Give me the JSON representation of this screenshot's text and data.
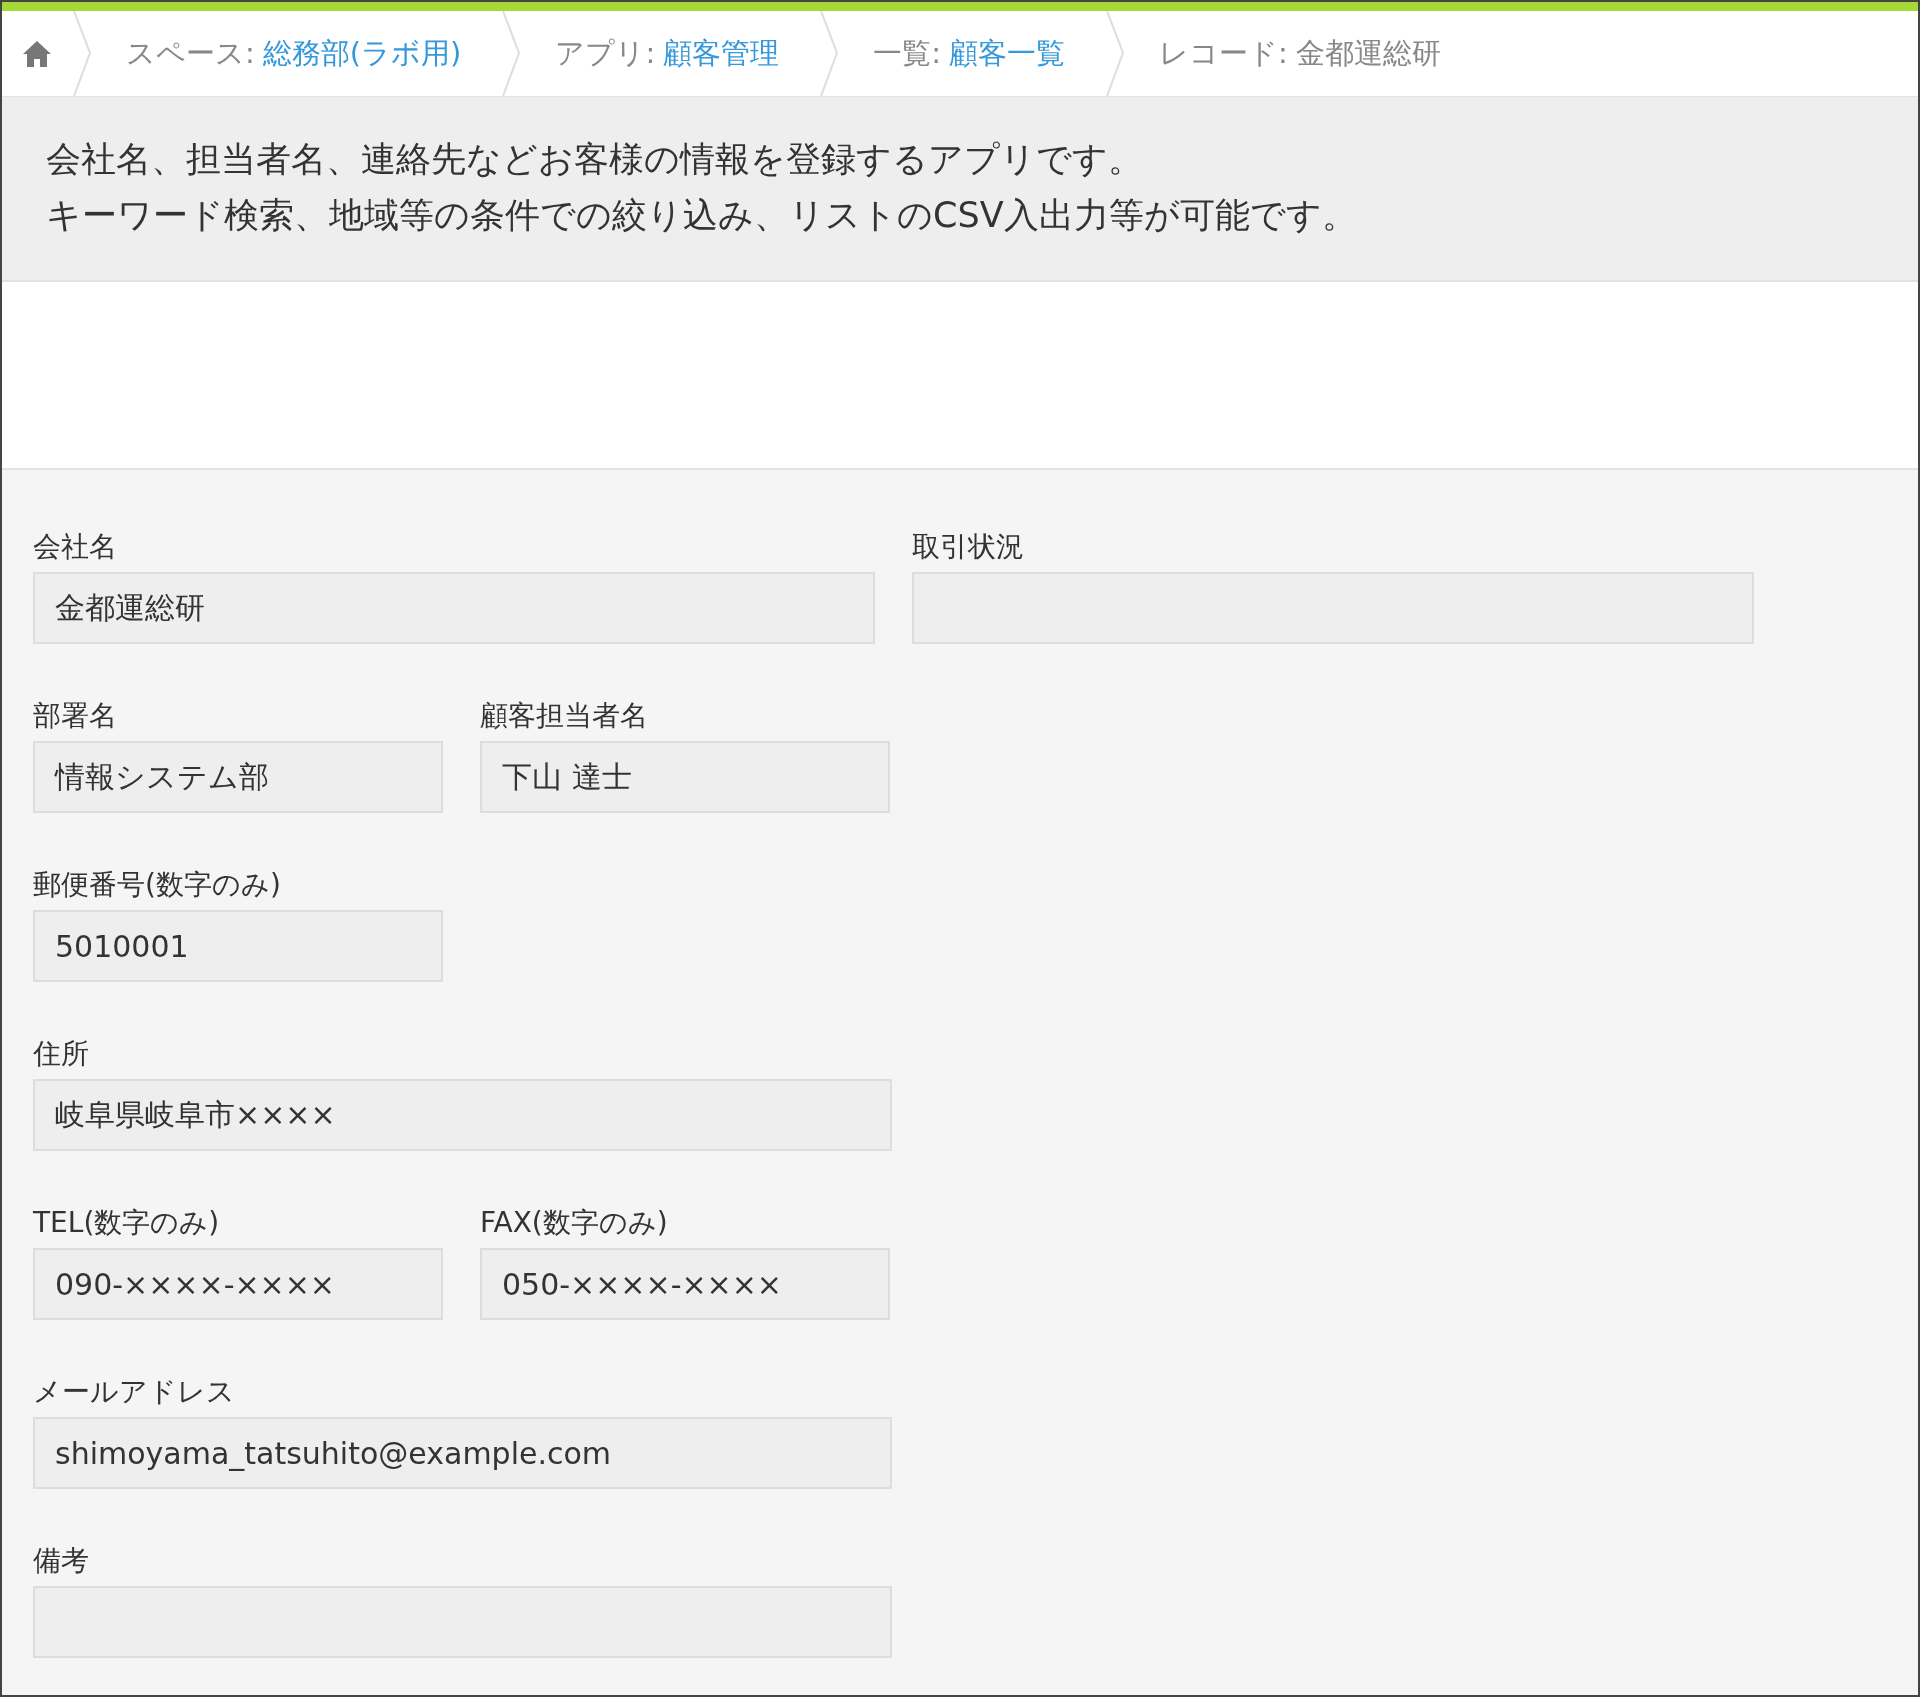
{
  "breadcrumb": [
    {
      "label": "スペース:",
      "link": "総務部(ラボ用)",
      "linked": true
    },
    {
      "label": "アプリ:",
      "link": "顧客管理",
      "linked": true
    },
    {
      "label": "一覧:",
      "link": "顧客一覧",
      "linked": true
    },
    {
      "label": "レコード:",
      "link": "金都運総研",
      "linked": false
    }
  ],
  "description": [
    "会社名、担当者名、連絡先などお客様の情報を登録するアプリです。",
    "キーワード検索、地域等の条件での絞り込み、リストのCSV入出力等が可能です。"
  ],
  "form": {
    "rows": [
      {
        "fields": [
          {
            "label": "会社名",
            "value": "金都運総研",
            "kind": "long"
          },
          {
            "label": "取引状況",
            "kind": "long"
          }
        ]
      },
      {
        "fields": [
          {
            "label": "部署名",
            "value": "情報システム部",
            "kind": "short"
          },
          {
            "label": "顧客担当者名",
            "value": "下山 達士",
            "kind": "short"
          }
        ]
      },
      {
        "fields": [
          {
            "label": "郵便番号(数字のみ)",
            "value": "5010001",
            "kind": "short"
          }
        ]
      },
      {
        "fields": [
          {
            "label": "住所",
            "value": "岐阜県岐阜市××××",
            "kind": "wide"
          }
        ]
      },
      {
        "fields": [
          {
            "label": "TEL(数字のみ)",
            "value": "090-××××-××××",
            "kind": "short"
          },
          {
            "label": "FAX(数字のみ)",
            "value": "050-××××-××××",
            "kind": "short"
          }
        ]
      },
      {
        "fields": [
          {
            "label": "メールアドレス",
            "value": "shimoyama_tatsuhito@example.com",
            "kind": "wide"
          }
        ]
      },
      {
        "fields": [
          {
            "label": "備考",
            "kind": "wide"
          }
        ]
      }
    ]
  }
}
